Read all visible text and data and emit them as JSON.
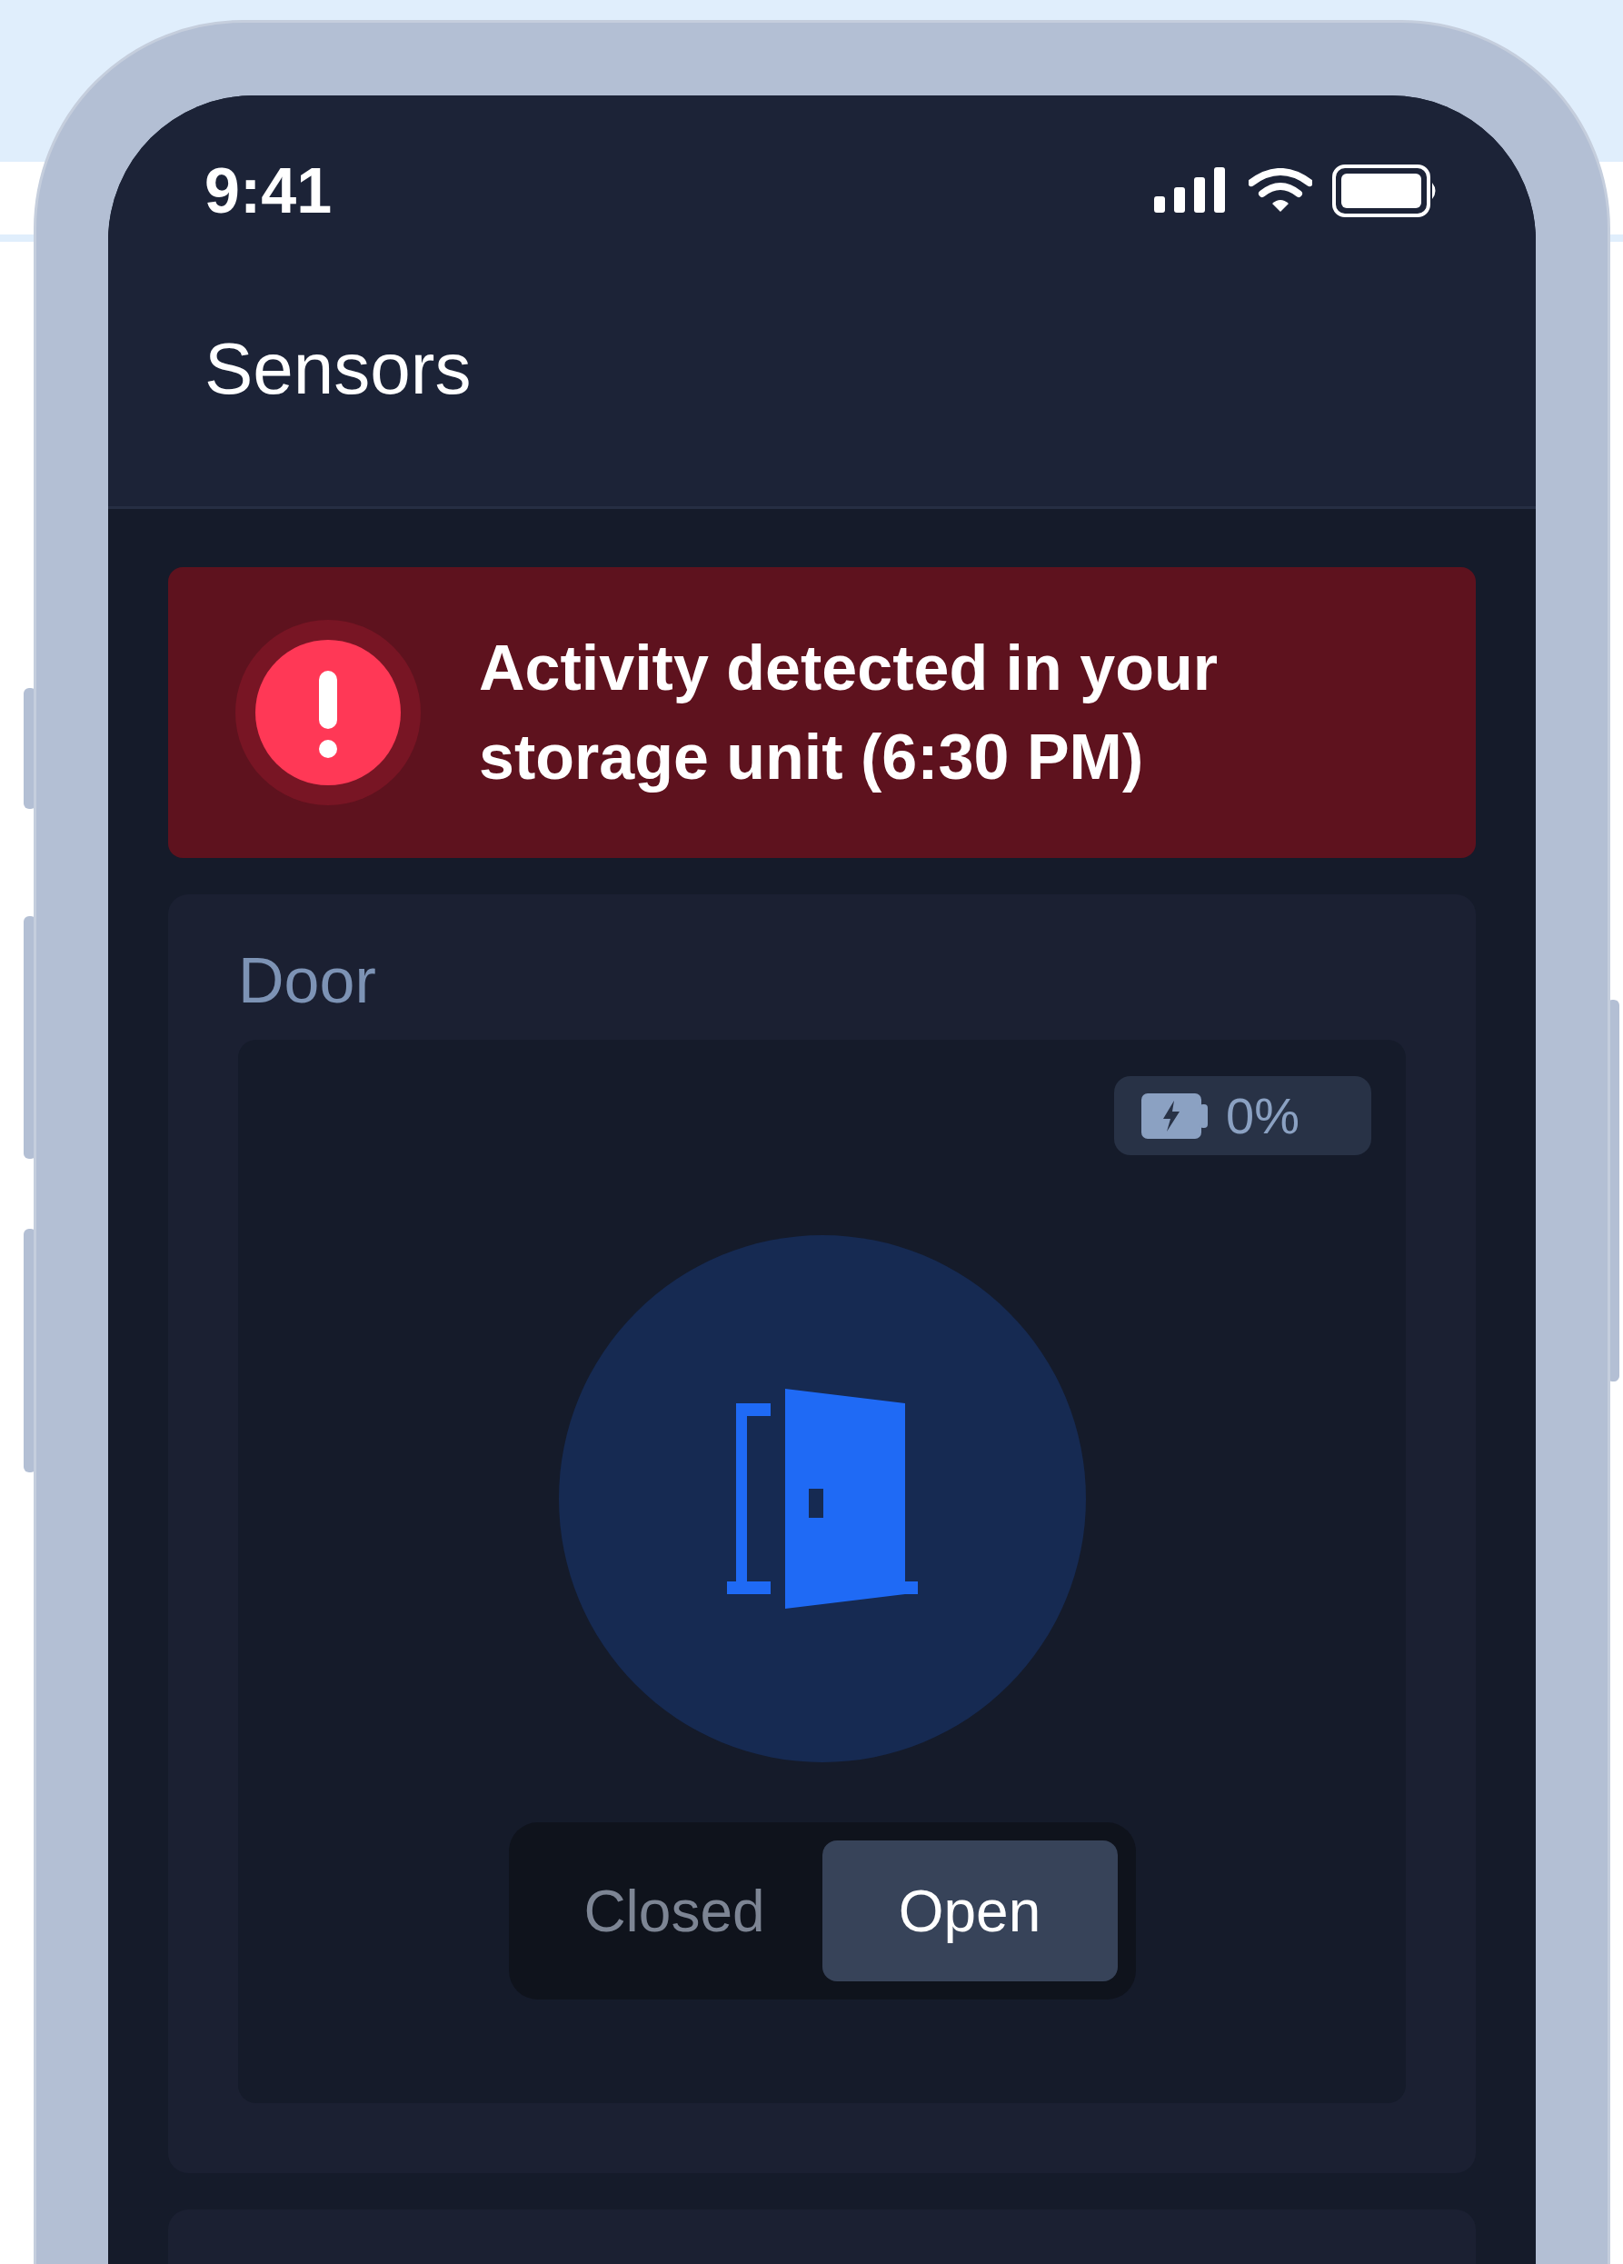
{
  "status_bar": {
    "time": "9:41"
  },
  "header": {
    "title": "Sensors"
  },
  "alert": {
    "message": "Activity detected in your storage unit (6:30 PM)"
  },
  "sensors": [
    {
      "kind": "door",
      "name": "Door",
      "battery": "0%",
      "states": [
        {
          "label": "Closed",
          "selected": false
        },
        {
          "label": "Open",
          "selected": true
        }
      ]
    }
  ]
}
